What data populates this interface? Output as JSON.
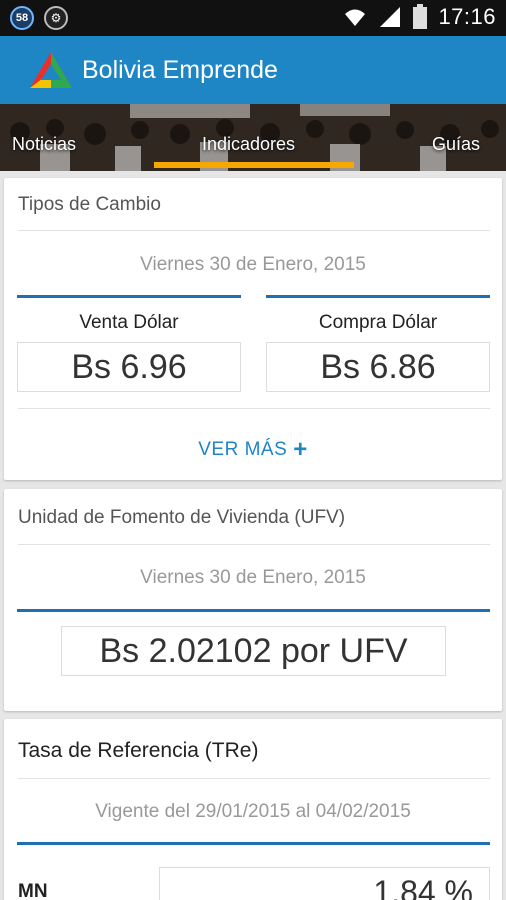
{
  "status_bar": {
    "notification_1": "58",
    "notification_2": "⚙",
    "time": "17:16"
  },
  "app_bar": {
    "title": "Bolivia Emprende",
    "colors": {
      "primary": "#1f86c6",
      "accent": "#f7a800"
    }
  },
  "tabs": [
    {
      "label": "Noticias"
    },
    {
      "label": "Indicadores",
      "selected": true
    },
    {
      "label": "Guías"
    }
  ],
  "exchange": {
    "title": "Tipos de Cambio",
    "date": "Viernes 30 de Enero, 2015",
    "sell_label": "Venta Dólar",
    "sell_value": "Bs 6.96",
    "buy_label": "Compra Dólar",
    "buy_value": "Bs 6.86",
    "more_label": "VER MÁS"
  },
  "ufv": {
    "title": "Unidad de Fomento de Vivienda (UFV)",
    "date": "Viernes 30 de Enero, 2015",
    "value": "Bs 2.02102  por UFV"
  },
  "tre": {
    "title": "Tasa de Referencia (TRe)",
    "validity": "Vigente del  29/01/2015  al  04/02/2015",
    "mn_label": "MN",
    "mn_value": "1.84 %"
  }
}
